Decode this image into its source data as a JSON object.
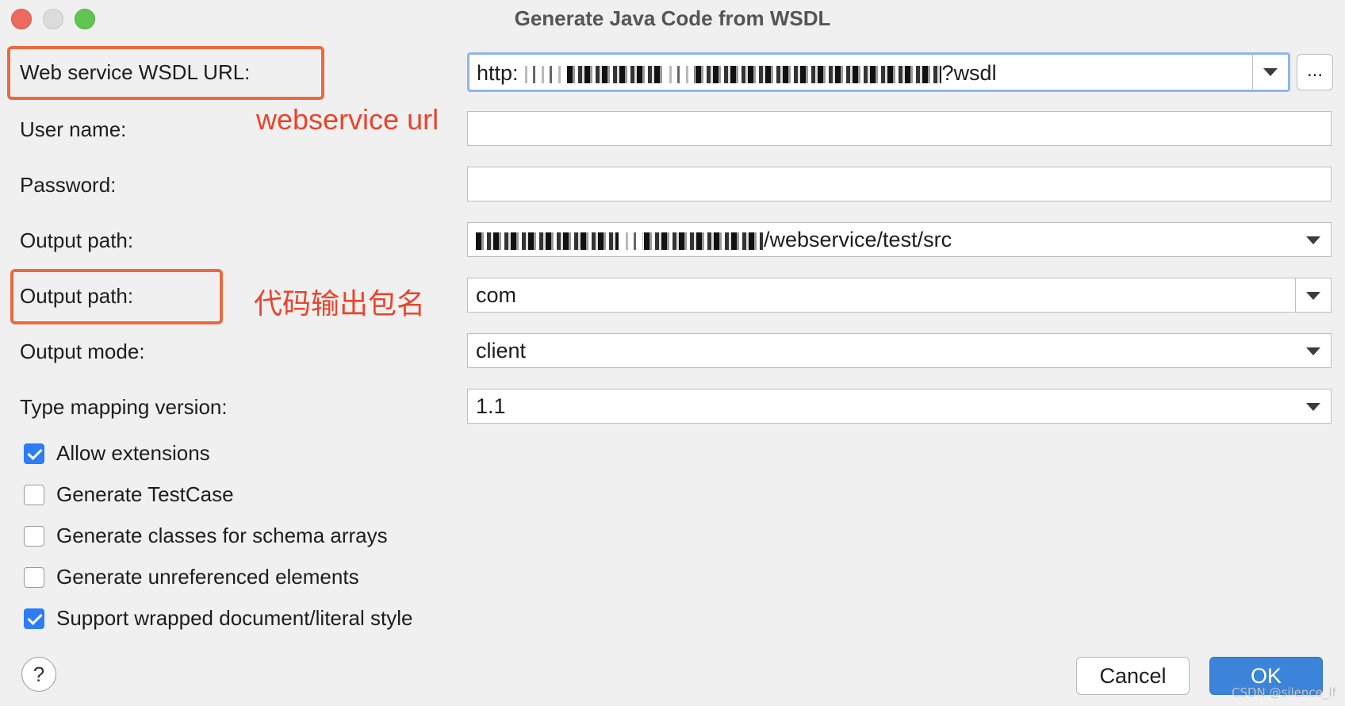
{
  "window": {
    "title": "Generate Java Code from WSDL"
  },
  "form": {
    "wsdl_url": {
      "label": "Web service WSDL URL:",
      "value_prefix": "http:",
      "value_suffix": "?wsdl",
      "browse_label": "..."
    },
    "user_name": {
      "label": "User name:",
      "value": ""
    },
    "password": {
      "label": "Password:",
      "value": ""
    },
    "output_path": {
      "label": "Output path:",
      "value_suffix": "/webservice/test/src"
    },
    "package_name": {
      "label": "Output path:",
      "value": "com"
    },
    "output_mode": {
      "label": "Output mode:",
      "value": "client"
    },
    "type_mapping_version": {
      "label": "Type mapping version:",
      "value": "1.1"
    }
  },
  "options": [
    {
      "label": "Allow extensions",
      "checked": true
    },
    {
      "label": "Generate TestCase",
      "checked": false
    },
    {
      "label": "Generate classes for schema arrays",
      "checked": false
    },
    {
      "label": "Generate unreferenced elements",
      "checked": false
    },
    {
      "label": "Support wrapped document/literal style",
      "checked": true
    }
  ],
  "footer": {
    "help_label": "?",
    "cancel_label": "Cancel",
    "ok_label": "OK"
  },
  "annotations": {
    "url_note": "webservice url",
    "package_note": "代码输出包名",
    "color": "#e8452c"
  },
  "watermark": "CSDN @silence_lf",
  "colors": {
    "accent": "#2e7cf6",
    "ok_button": "#3c84d9",
    "annotation_box": "#ea6a3f",
    "focus_ring": "#8fb6ea"
  }
}
